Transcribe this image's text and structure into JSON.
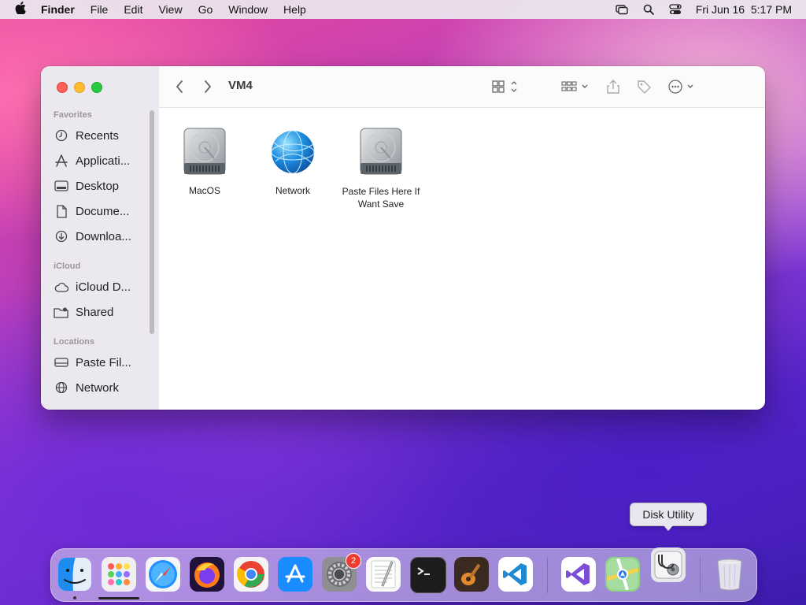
{
  "menubar": {
    "app_name": "Finder",
    "menus": [
      "File",
      "Edit",
      "View",
      "Go",
      "Window",
      "Help"
    ],
    "clock": "Fri Jun 16  5:17 PM"
  },
  "window": {
    "title": "VM4",
    "sidebar": {
      "sections": [
        "Favorites",
        "iCloud",
        "Locations"
      ],
      "favorites": [
        "Recents",
        "Applicati...",
        "Desktop",
        "Docume...",
        "Downloa..."
      ],
      "icloud": [
        "iCloud D...",
        "Shared"
      ],
      "locations": [
        "Paste Fil...",
        "Network"
      ]
    },
    "files": [
      {
        "name": "MacOS",
        "icon": "hard-drive-icon"
      },
      {
        "name": "Network",
        "icon": "network-globe-icon"
      },
      {
        "name": "Paste Files Here If Want Save",
        "icon": "hard-drive-icon"
      }
    ]
  },
  "tooltip": {
    "text": "Disk Utility"
  },
  "dock": {
    "apps": [
      "Finder",
      "Launchpad",
      "Safari",
      "Firefox",
      "Chrome",
      "App Store",
      "System Preferences",
      "TextEdit",
      "Terminal",
      "GarageBand",
      "Visual Studio Code",
      "Visual Studio",
      "Maps",
      "Disk Utility",
      "Trash"
    ],
    "badge_count": "2"
  },
  "colors": {
    "accent": "#0a84ff",
    "close": "#fe5f57",
    "minimize": "#febc2e",
    "zoom": "#28c840",
    "badge": "#f23b30"
  }
}
